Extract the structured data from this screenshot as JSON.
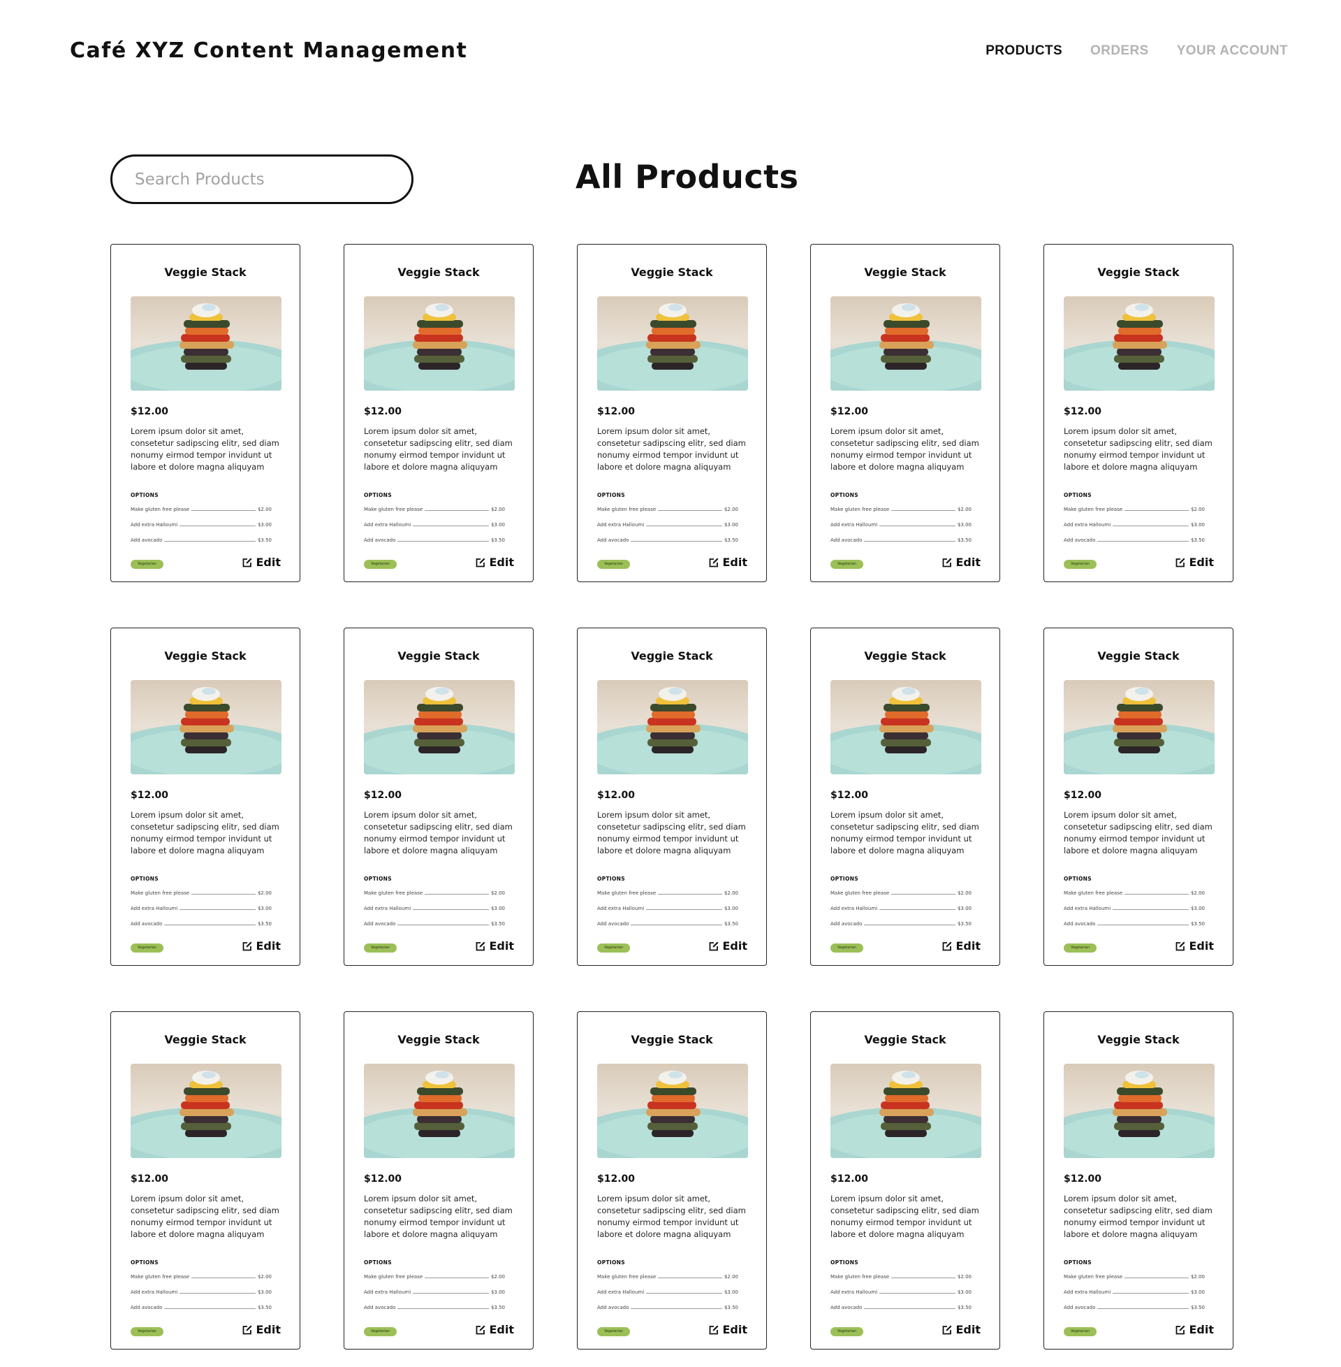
{
  "header": {
    "app_title": "Café XYZ Content Management",
    "nav": [
      {
        "label": "PRODUCTS",
        "active": true
      },
      {
        "label": "ORDERS",
        "active": false
      },
      {
        "label": "YOUR ACCOUNT",
        "active": false
      }
    ]
  },
  "search": {
    "placeholder": "Search Products",
    "value": ""
  },
  "page_title": "All Products",
  "colors": {
    "badge": "#9cbf57",
    "text": "#111111",
    "nav_inactive": "#b3b3b3"
  },
  "products": [
    {
      "title": "Veggie Stack",
      "price": "$12.00",
      "description": "Lorem ipsum dolor sit amet, consetetur sadipscing elitr, sed diam nonumy eirmod tempor invidunt ut labore et dolore magna aliquyam",
      "options_label": "OPTIONS",
      "options": [
        {
          "name": "Make gluten free please",
          "price": "$2.00"
        },
        {
          "name": "Add extra Halloumi",
          "price": "$3.00"
        },
        {
          "name": "Add avocado",
          "price": "$3.50"
        }
      ],
      "badge": "Vegetarian",
      "edit_label": "Edit"
    },
    {
      "title": "Veggie Stack",
      "price": "$12.00",
      "description": "Lorem ipsum dolor sit amet, consetetur sadipscing elitr, sed diam nonumy eirmod tempor invidunt ut labore et dolore magna aliquyam",
      "options_label": "OPTIONS",
      "options": [
        {
          "name": "Make gluten free please",
          "price": "$2.00"
        },
        {
          "name": "Add extra Halloumi",
          "price": "$3.00"
        },
        {
          "name": "Add avocado",
          "price": "$3.50"
        }
      ],
      "badge": "Vegetarian",
      "edit_label": "Edit"
    },
    {
      "title": "Veggie Stack",
      "price": "$12.00",
      "description": "Lorem ipsum dolor sit amet, consetetur sadipscing elitr, sed diam nonumy eirmod tempor invidunt ut labore et dolore magna aliquyam",
      "options_label": "OPTIONS",
      "options": [
        {
          "name": "Make gluten free please",
          "price": "$2.00"
        },
        {
          "name": "Add extra Halloumi",
          "price": "$3.00"
        },
        {
          "name": "Add avocado",
          "price": "$3.50"
        }
      ],
      "badge": "Vegetarian",
      "edit_label": "Edit"
    },
    {
      "title": "Veggie Stack",
      "price": "$12.00",
      "description": "Lorem ipsum dolor sit amet, consetetur sadipscing elitr, sed diam nonumy eirmod tempor invidunt ut labore et dolore magna aliquyam",
      "options_label": "OPTIONS",
      "options": [
        {
          "name": "Make gluten free please",
          "price": "$2.00"
        },
        {
          "name": "Add extra Halloumi",
          "price": "$3.00"
        },
        {
          "name": "Add avocado",
          "price": "$3.50"
        }
      ],
      "badge": "Vegetarian",
      "edit_label": "Edit"
    },
    {
      "title": "Veggie Stack",
      "price": "$12.00",
      "description": "Lorem ipsum dolor sit amet, consetetur sadipscing elitr, sed diam nonumy eirmod tempor invidunt ut labore et dolore magna aliquyam",
      "options_label": "OPTIONS",
      "options": [
        {
          "name": "Make gluten free please",
          "price": "$2.00"
        },
        {
          "name": "Add extra Halloumi",
          "price": "$3.00"
        },
        {
          "name": "Add avocado",
          "price": "$3.50"
        }
      ],
      "badge": "Vegetarian",
      "edit_label": "Edit"
    },
    {
      "title": "Veggie Stack",
      "price": "$12.00",
      "description": "Lorem ipsum dolor sit amet, consetetur sadipscing elitr, sed diam nonumy eirmod tempor invidunt ut labore et dolore magna aliquyam",
      "options_label": "OPTIONS",
      "options": [
        {
          "name": "Make gluten free please",
          "price": "$2.00"
        },
        {
          "name": "Add extra Halloumi",
          "price": "$3.00"
        },
        {
          "name": "Add avocado",
          "price": "$3.50"
        }
      ],
      "badge": "Vegetarian",
      "edit_label": "Edit"
    },
    {
      "title": "Veggie Stack",
      "price": "$12.00",
      "description": "Lorem ipsum dolor sit amet, consetetur sadipscing elitr, sed diam nonumy eirmod tempor invidunt ut labore et dolore magna aliquyam",
      "options_label": "OPTIONS",
      "options": [
        {
          "name": "Make gluten free please",
          "price": "$2.00"
        },
        {
          "name": "Add extra Halloumi",
          "price": "$3.00"
        },
        {
          "name": "Add avocado",
          "price": "$3.50"
        }
      ],
      "badge": "Vegetarian",
      "edit_label": "Edit"
    },
    {
      "title": "Veggie Stack",
      "price": "$12.00",
      "description": "Lorem ipsum dolor sit amet, consetetur sadipscing elitr, sed diam nonumy eirmod tempor invidunt ut labore et dolore magna aliquyam",
      "options_label": "OPTIONS",
      "options": [
        {
          "name": "Make gluten free please",
          "price": "$2.00"
        },
        {
          "name": "Add extra Halloumi",
          "price": "$3.00"
        },
        {
          "name": "Add avocado",
          "price": "$3.50"
        }
      ],
      "badge": "Vegetarian",
      "edit_label": "Edit"
    },
    {
      "title": "Veggie Stack",
      "price": "$12.00",
      "description": "Lorem ipsum dolor sit amet, consetetur sadipscing elitr, sed diam nonumy eirmod tempor invidunt ut labore et dolore magna aliquyam",
      "options_label": "OPTIONS",
      "options": [
        {
          "name": "Make gluten free please",
          "price": "$2.00"
        },
        {
          "name": "Add extra Halloumi",
          "price": "$3.00"
        },
        {
          "name": "Add avocado",
          "price": "$3.50"
        }
      ],
      "badge": "Vegetarian",
      "edit_label": "Edit"
    },
    {
      "title": "Veggie Stack",
      "price": "$12.00",
      "description": "Lorem ipsum dolor sit amet, consetetur sadipscing elitr, sed diam nonumy eirmod tempor invidunt ut labore et dolore magna aliquyam",
      "options_label": "OPTIONS",
      "options": [
        {
          "name": "Make gluten free please",
          "price": "$2.00"
        },
        {
          "name": "Add extra Halloumi",
          "price": "$3.00"
        },
        {
          "name": "Add avocado",
          "price": "$3.50"
        }
      ],
      "badge": "Vegetarian",
      "edit_label": "Edit"
    },
    {
      "title": "Veggie Stack",
      "price": "$12.00",
      "description": "Lorem ipsum dolor sit amet, consetetur sadipscing elitr, sed diam nonumy eirmod tempor invidunt ut labore et dolore magna aliquyam",
      "options_label": "OPTIONS",
      "options": [
        {
          "name": "Make gluten free please",
          "price": "$2.00"
        },
        {
          "name": "Add extra Halloumi",
          "price": "$3.00"
        },
        {
          "name": "Add avocado",
          "price": "$3.50"
        }
      ],
      "badge": "Vegetarian",
      "edit_label": "Edit"
    },
    {
      "title": "Veggie Stack",
      "price": "$12.00",
      "description": "Lorem ipsum dolor sit amet, consetetur sadipscing elitr, sed diam nonumy eirmod tempor invidunt ut labore et dolore magna aliquyam",
      "options_label": "OPTIONS",
      "options": [
        {
          "name": "Make gluten free please",
          "price": "$2.00"
        },
        {
          "name": "Add extra Halloumi",
          "price": "$3.00"
        },
        {
          "name": "Add avocado",
          "price": "$3.50"
        }
      ],
      "badge": "Vegetarian",
      "edit_label": "Edit"
    },
    {
      "title": "Veggie Stack",
      "price": "$12.00",
      "description": "Lorem ipsum dolor sit amet, consetetur sadipscing elitr, sed diam nonumy eirmod tempor invidunt ut labore et dolore magna aliquyam",
      "options_label": "OPTIONS",
      "options": [
        {
          "name": "Make gluten free please",
          "price": "$2.00"
        },
        {
          "name": "Add extra Halloumi",
          "price": "$3.00"
        },
        {
          "name": "Add avocado",
          "price": "$3.50"
        }
      ],
      "badge": "Vegetarian",
      "edit_label": "Edit"
    },
    {
      "title": "Veggie Stack",
      "price": "$12.00",
      "description": "Lorem ipsum dolor sit amet, consetetur sadipscing elitr, sed diam nonumy eirmod tempor invidunt ut labore et dolore magna aliquyam",
      "options_label": "OPTIONS",
      "options": [
        {
          "name": "Make gluten free please",
          "price": "$2.00"
        },
        {
          "name": "Add extra Halloumi",
          "price": "$3.00"
        },
        {
          "name": "Add avocado",
          "price": "$3.50"
        }
      ],
      "badge": "Vegetarian",
      "edit_label": "Edit"
    },
    {
      "title": "Veggie Stack",
      "price": "$12.00",
      "description": "Lorem ipsum dolor sit amet, consetetur sadipscing elitr, sed diam nonumy eirmod tempor invidunt ut labore et dolore magna aliquyam",
      "options_label": "OPTIONS",
      "options": [
        {
          "name": "Make gluten free please",
          "price": "$2.00"
        },
        {
          "name": "Add extra Halloumi",
          "price": "$3.00"
        },
        {
          "name": "Add avocado",
          "price": "$3.50"
        }
      ],
      "badge": "Vegetarian",
      "edit_label": "Edit"
    }
  ]
}
